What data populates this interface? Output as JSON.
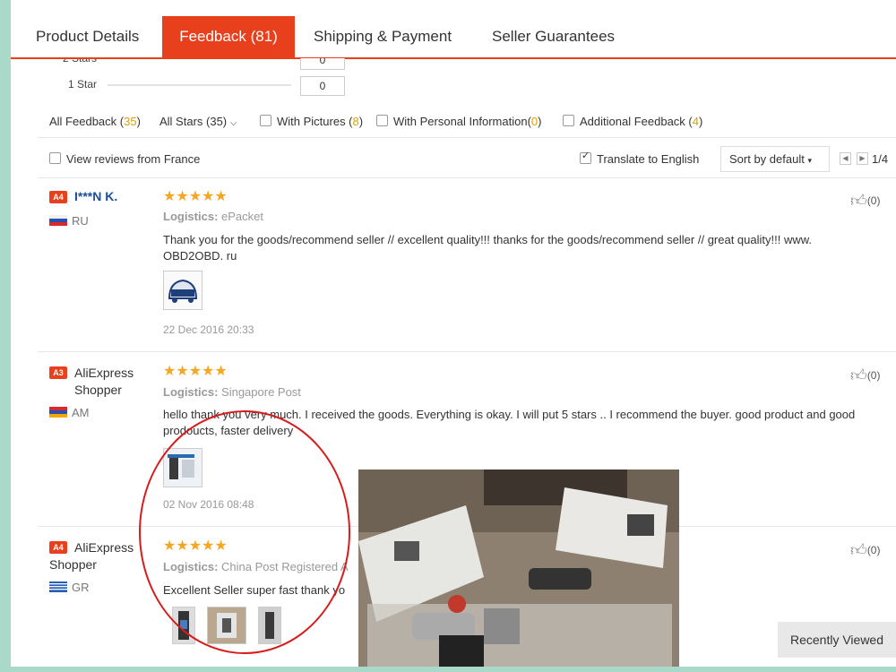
{
  "tabs": [
    {
      "label": "Product Details"
    },
    {
      "label": "Feedback (81)"
    },
    {
      "label": "Shipping & Payment"
    },
    {
      "label": "Seller Guarantees"
    }
  ],
  "star_rows": [
    {
      "label": "2 Stars",
      "count": "0"
    },
    {
      "label": "1 Star",
      "count": "0"
    }
  ],
  "filters": {
    "all_feedback": "All Feedback (",
    "all_feedback_num": "35",
    "close": ")",
    "all_stars": "All Stars (35)",
    "with_pictures": "With Pictures (",
    "with_pictures_num": "8",
    "with_personal": "With Personal Information(",
    "with_personal_num": "0",
    "additional": "Additional Feedback (",
    "additional_num": "4",
    "view_france": "View reviews from France",
    "translate": "Translate to English",
    "sort": "Sort by default",
    "page": "1/4"
  },
  "reviews": [
    {
      "badge": "A4",
      "name": "I***N K.",
      "country": "RU",
      "stars": "★★★★★",
      "logistics_label": "Logistics:",
      "logistics": "ePacket",
      "text": "Thank you for the goods/recommend seller // excellent quality!!! thanks for the goods/recommend seller // great quality!!! www. OBD2OBD. ru",
      "date": "22 Dec 2016 20:33",
      "likes": "(0)"
    },
    {
      "badge": "A3",
      "name": "AliExpress Shopper",
      "country": "AM",
      "stars": "★★★★★",
      "logistics_label": "Logistics:",
      "logistics": "Singapore Post",
      "text": "hello thank you very much. I received the goods. Everything is okay. I will put 5 stars .. I recommend the buyer. good product and good prodoucts, faster delivery",
      "date": "02 Nov 2016 08:48",
      "likes": "(0)"
    },
    {
      "badge": "A4",
      "name": "AliExpress Shopper",
      "country": "GR",
      "stars": "★★★★★",
      "logistics_label": "Logistics:",
      "logistics": "China Post Registered A",
      "text": "Excellent Seller super fast thank yo",
      "likes": "(0)"
    }
  ],
  "recently_viewed": "Recently Viewed",
  "colors": {
    "accent": "#e8401c",
    "star": "#f5a623",
    "link": "#1a4f9c"
  }
}
